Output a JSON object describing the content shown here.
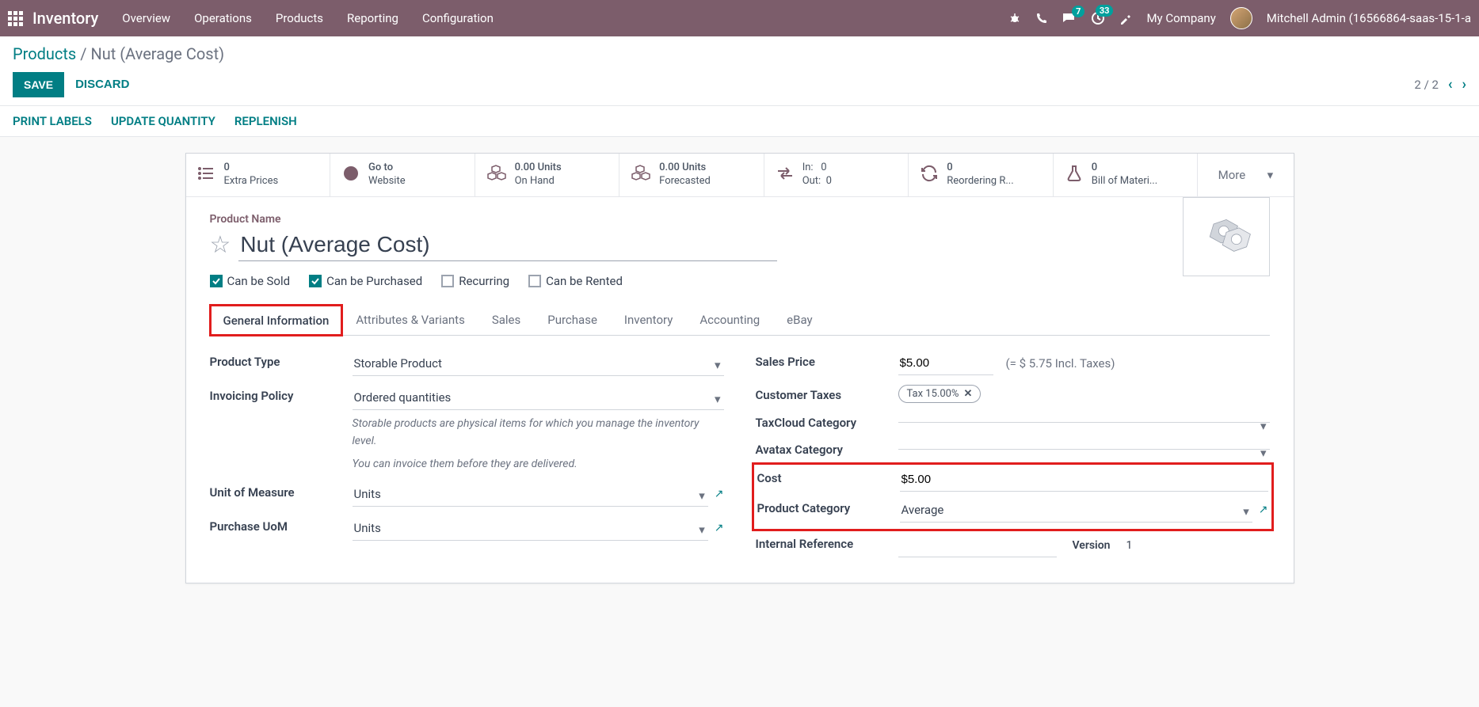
{
  "topbar": {
    "brand": "Inventory",
    "menu": [
      "Overview",
      "Operations",
      "Products",
      "Reporting",
      "Configuration"
    ],
    "msg_badge": "7",
    "activity_badge": "33",
    "company": "My Company",
    "user": "Mitchell Admin (16566864-saas-15-1-a"
  },
  "breadcrumb": {
    "root": "Products",
    "current": "Nut (Average Cost)"
  },
  "actions": {
    "save": "SAVE",
    "discard": "DISCARD"
  },
  "pager": {
    "text": "2 / 2"
  },
  "toolbar": {
    "print": "PRINT LABELS",
    "update": "UPDATE QUANTITY",
    "replenish": "REPLENISH"
  },
  "stats": {
    "extra_prices": {
      "val": "0",
      "label": "Extra Prices"
    },
    "website": {
      "val": "Go to",
      "label": "Website"
    },
    "on_hand": {
      "val": "0.00 Units",
      "label": "On Hand"
    },
    "forecasted": {
      "val": "0.00 Units",
      "label": "Forecasted"
    },
    "inout": {
      "in_label": "In:",
      "in_val": "0",
      "out_label": "Out:",
      "out_val": "0"
    },
    "reordering": {
      "val": "0",
      "label": "Reordering R..."
    },
    "bom": {
      "val": "0",
      "label": "Bill of Materi..."
    },
    "more": "More"
  },
  "product": {
    "name_label": "Product Name",
    "name": "Nut (Average Cost)",
    "checks": {
      "sold": "Can be Sold",
      "purchased": "Can be Purchased",
      "recurring": "Recurring",
      "rented": "Can be Rented"
    }
  },
  "tabs": [
    "General Information",
    "Attributes & Variants",
    "Sales",
    "Purchase",
    "Inventory",
    "Accounting",
    "eBay"
  ],
  "fields": {
    "product_type": {
      "label": "Product Type",
      "value": "Storable Product"
    },
    "invoicing_policy": {
      "label": "Invoicing Policy",
      "value": "Ordered quantities"
    },
    "help1": "Storable products are physical items for which you manage the inventory level.",
    "help2": "You can invoice them before they are delivered.",
    "uom": {
      "label": "Unit of Measure",
      "value": "Units"
    },
    "purchase_uom": {
      "label": "Purchase UoM",
      "value": "Units"
    },
    "sales_price": {
      "label": "Sales Price",
      "value": "$5.00",
      "note": "(= $ 5.75 Incl. Taxes)"
    },
    "customer_taxes": {
      "label": "Customer Taxes",
      "tag": "Tax 15.00%"
    },
    "taxcloud": {
      "label": "TaxCloud Category"
    },
    "avatax": {
      "label": "Avatax Category"
    },
    "cost": {
      "label": "Cost",
      "value": "$5.00"
    },
    "category": {
      "label": "Product Category",
      "value": "Average"
    },
    "internal_ref": {
      "label": "Internal Reference"
    },
    "version": {
      "label": "Version",
      "value": "1"
    }
  }
}
